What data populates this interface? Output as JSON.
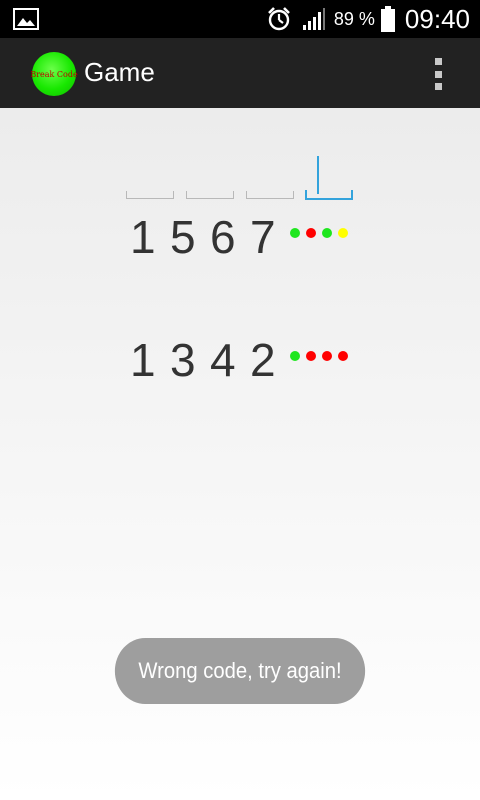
{
  "status_bar": {
    "battery_percent": "89 %",
    "time": "09:40",
    "icons": [
      "gallery-icon",
      "alarm-icon",
      "signal-icon",
      "battery-icon"
    ]
  },
  "action_bar": {
    "logo_text": "Break Code",
    "title": "Game",
    "menu_icon": "overflow-menu-icon"
  },
  "input_slots": {
    "count": 4,
    "active_index": 3
  },
  "guesses": [
    {
      "digits": [
        "1",
        "5",
        "6",
        "7"
      ],
      "pegs": [
        "#1ee61e",
        "#ff0000",
        "#1ee61e",
        "#ffff00"
      ]
    },
    {
      "digits": [
        "1",
        "3",
        "4",
        "2"
      ],
      "pegs": [
        "#1ee61e",
        "#ff0000",
        "#ff0000",
        "#ff0000"
      ]
    }
  ],
  "toast": {
    "message": "Wrong code, try again!"
  },
  "colors": {
    "accent": "#33a3dc",
    "peg_green": "#1ee61e",
    "peg_red": "#ff0000",
    "peg_yellow": "#ffff00",
    "toast_bg": "#9e9e9e"
  }
}
